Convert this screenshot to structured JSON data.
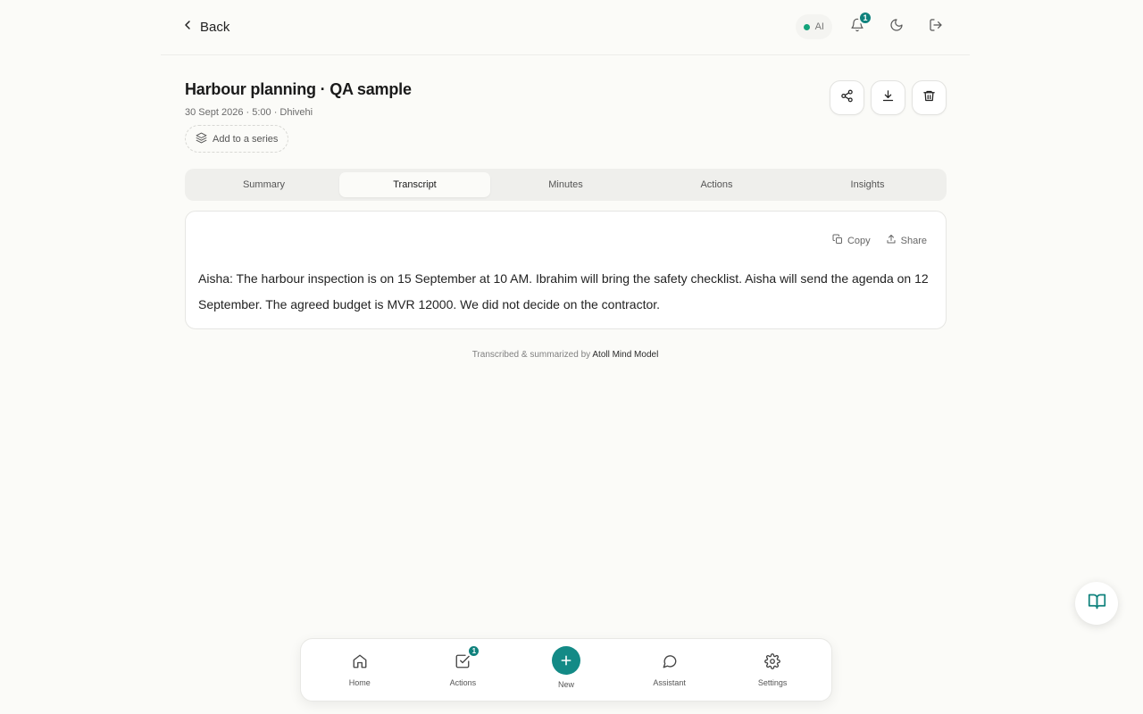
{
  "topbar": {
    "back_label": "Back",
    "ai_label": "AI",
    "notification_count": "1",
    "colors": {
      "ai_status": "#12a37a",
      "accent": "#10827d"
    }
  },
  "meeting": {
    "title": "Harbour planning · QA sample",
    "meta": "30 Sept 2026 · 5:00 · Dhivehi",
    "series_label": "Add to a series"
  },
  "tabs": [
    {
      "label": "Summary",
      "active": false
    },
    {
      "label": "Transcript",
      "active": true
    },
    {
      "label": "Minutes",
      "active": false
    },
    {
      "label": "Actions",
      "active": false
    },
    {
      "label": "Insights",
      "active": false
    }
  ],
  "transcript": {
    "copy_label": "Copy",
    "share_label": "Share",
    "text": "Aisha: The harbour inspection is on 15 September at 10 AM. Ibrahim will bring the safety checklist. Aisha will send the agenda on 12 September. The agreed budget is MVR 12000. We did not decide on the contractor."
  },
  "footer": {
    "prefix": "Transcribed & summarized by",
    "model": "Atoll Mind Model"
  },
  "bottom_nav": {
    "items": [
      {
        "label": "Home",
        "icon": "home-icon"
      },
      {
        "label": "Actions",
        "icon": "checkbox-icon",
        "badge": "1"
      },
      {
        "label": "New",
        "icon": "plus-icon"
      },
      {
        "label": "Assistant",
        "icon": "chat-bubble-icon"
      },
      {
        "label": "Settings",
        "icon": "gear-icon"
      }
    ]
  }
}
